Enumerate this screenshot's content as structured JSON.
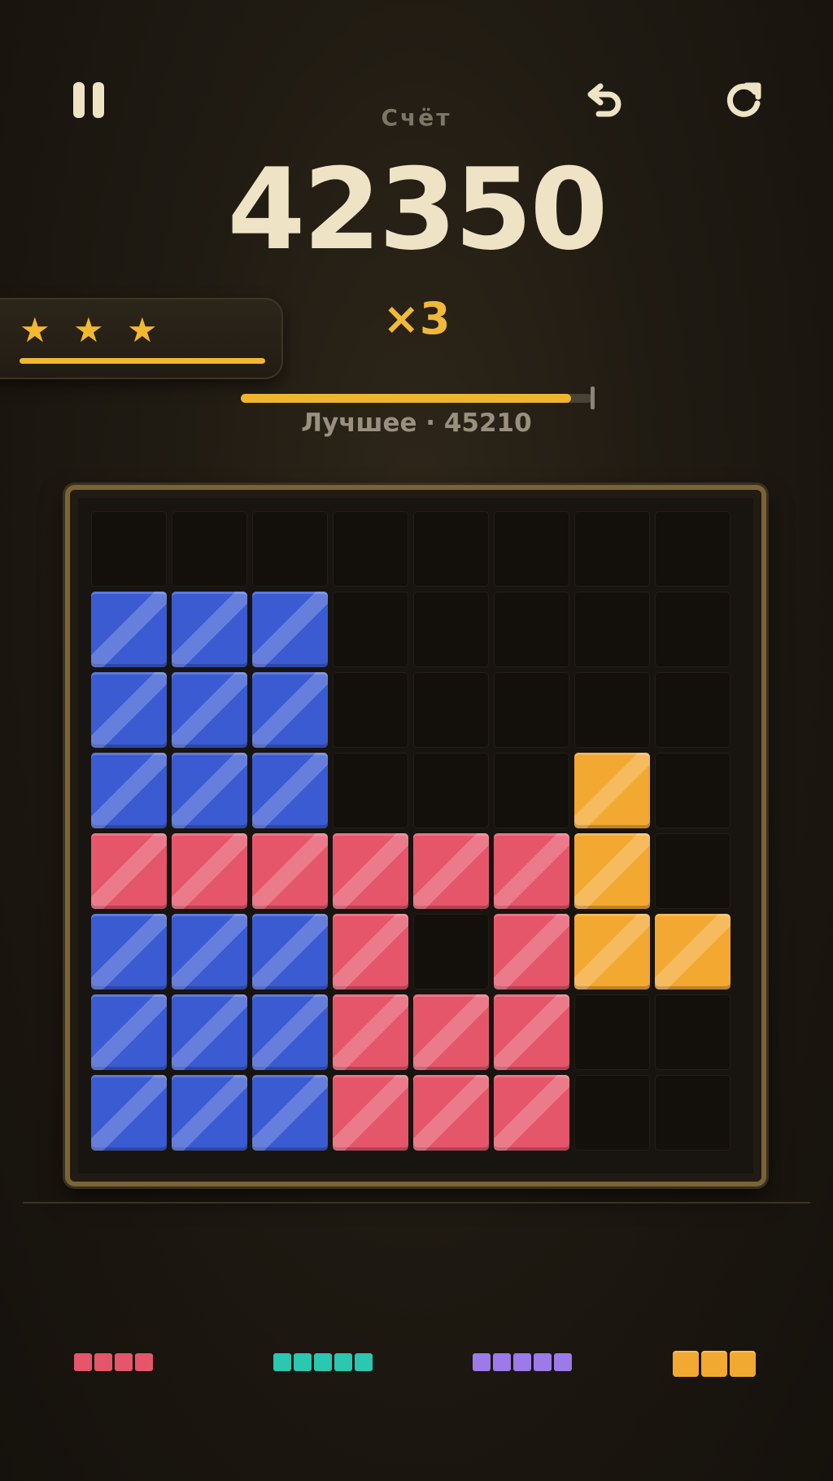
{
  "header": {
    "score_label": "Счёт",
    "score_value": "42350",
    "multiplier": "×3",
    "best_label": "Лучшее · 45210",
    "best_progress": 0.94,
    "stars_count": 3,
    "stars_progress": 1.0
  },
  "icons": {
    "pause": "pause-icon",
    "undo": "undo-icon",
    "restart": "restart-icon",
    "star": "star-icon"
  },
  "colors": {
    "blue": "#3b5bd3",
    "red": "#e5566a",
    "orange": "#f2a831",
    "teal": "#2bc7b0",
    "purple": "#9c7ae8",
    "accent": "#f2b830"
  },
  "board": {
    "size": 8,
    "rows": [
      "........",
      "BBB.....",
      "BBB.....",
      "BBB...O.",
      "RRRRRRO.",
      "BBBR.ROO",
      "BBBRRR..",
      "BBBRRR.."
    ]
  },
  "tray": {
    "pieces": [
      {
        "color": "red",
        "cells": 4
      },
      {
        "color": "teal",
        "cells": 5
      },
      {
        "color": "purple",
        "cells": 5
      },
      {
        "color": "orange",
        "cells": 3
      }
    ]
  }
}
